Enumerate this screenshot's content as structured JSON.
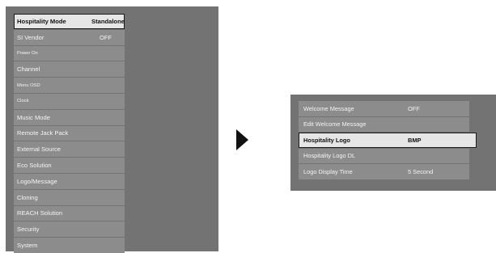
{
  "left_menu": {
    "items": [
      {
        "label": "Hospitality Mode",
        "value": "Standalone"
      },
      {
        "label": "SI Vendor",
        "value": "OFF"
      },
      {
        "label": "Power On"
      },
      {
        "label": "Channel"
      },
      {
        "label": "Menu OSD"
      },
      {
        "label": "Clock"
      },
      {
        "label": "Music Mode"
      },
      {
        "label": "Remote Jack Pack"
      },
      {
        "label": "External Source"
      },
      {
        "label": "Eco Solution"
      },
      {
        "label": "Logo/Message"
      },
      {
        "label": "Cloning"
      },
      {
        "label": "REACH Solution"
      },
      {
        "label": "Security"
      },
      {
        "label": "System"
      }
    ]
  },
  "right_menu": {
    "items": [
      {
        "label": "Welcome Message",
        "value": "OFF"
      },
      {
        "label": "Edit Welcome Message"
      },
      {
        "label": "Hospitality Logo",
        "value": "BMP"
      },
      {
        "label": "Hospitality Logo DL"
      },
      {
        "label": "Logo Display Time",
        "value": "5 Second"
      }
    ]
  },
  "icons": {
    "arrow": "play-arrow-right-icon"
  }
}
